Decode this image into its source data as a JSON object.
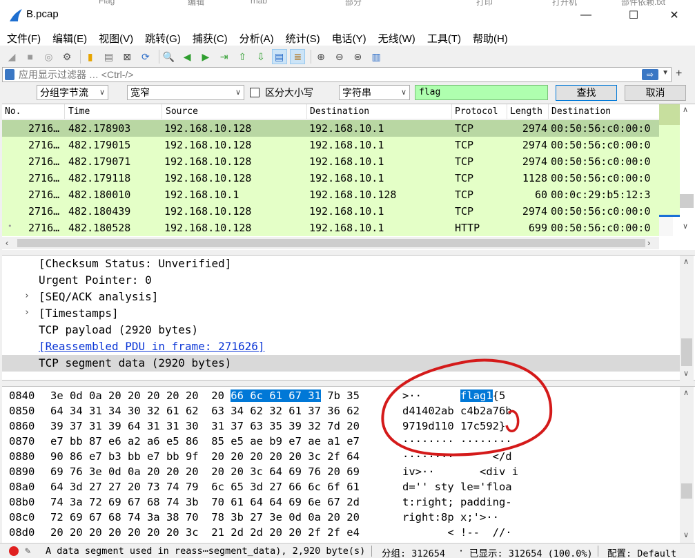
{
  "window": {
    "title": "B.pcap",
    "background_titles": [
      "Flag",
      "编辑",
      "rnab",
      "部分",
      "打印",
      "打开机",
      "部件依赖.txt"
    ],
    "controls": {
      "minimize": "—",
      "maximize": "☐",
      "close": "✕"
    }
  },
  "menu": [
    "文件(F)",
    "编辑(E)",
    "视图(V)",
    "跳转(G)",
    "捕获(C)",
    "分析(A)",
    "统计(S)",
    "电话(Y)",
    "无线(W)",
    "工具(T)",
    "帮助(H)"
  ],
  "toolbar": {
    "icons": [
      "shark-start-icon",
      "stop-icon",
      "restart-icon",
      "options-gear-icon",
      "open-folder-icon",
      "file-icon",
      "close-file-icon",
      "reload-icon",
      "find-icon",
      "go-back-icon",
      "go-forward-icon",
      "go-to-packet-icon",
      "go-first-icon",
      "go-last-icon",
      "autoscroll-icon",
      "colorize-icon",
      "zoom-in-icon",
      "zoom-out-icon",
      "zoom-normal-icon",
      "resize-columns-icon"
    ],
    "glyphs": [
      "◢",
      "■",
      "◎",
      "⚙",
      "▮",
      "▤",
      "⊠",
      "⟳",
      "🔍",
      "◀",
      "▶",
      "⇥",
      "⇧",
      "⇩",
      "▤",
      "≣",
      "⊕",
      "⊖",
      "⊜",
      "▥"
    ]
  },
  "display_filter": {
    "placeholder": "应用显示过滤器 … <Ctrl-/>",
    "apply_arrow": "⇨",
    "add": "+"
  },
  "find": {
    "search_in": "分组字节流",
    "charset": "宽窄",
    "case_sensitive_label": "区分大小写",
    "search_type": "字符串",
    "query": "flag",
    "find_button": "查找",
    "cancel_button": "取消"
  },
  "packet_list": {
    "columns": [
      "No.",
      "Time",
      "Source",
      "Destination",
      "Protocol",
      "Length",
      "Destination"
    ],
    "rows": [
      {
        "no": "2716…",
        "time": "482.178903",
        "src": "192.168.10.128",
        "dst": "192.168.10.1",
        "proto": "TCP",
        "len": "2974",
        "dst2": "00:50:56:c0:00:0"
      },
      {
        "no": "2716…",
        "time": "482.179015",
        "src": "192.168.10.128",
        "dst": "192.168.10.1",
        "proto": "TCP",
        "len": "2974",
        "dst2": "00:50:56:c0:00:0"
      },
      {
        "no": "2716…",
        "time": "482.179071",
        "src": "192.168.10.128",
        "dst": "192.168.10.1",
        "proto": "TCP",
        "len": "2974",
        "dst2": "00:50:56:c0:00:0"
      },
      {
        "no": "2716…",
        "time": "482.179118",
        "src": "192.168.10.128",
        "dst": "192.168.10.1",
        "proto": "TCP",
        "len": "1128",
        "dst2": "00:50:56:c0:00:0"
      },
      {
        "no": "2716…",
        "time": "482.180010",
        "src": "192.168.10.1",
        "dst": "192.168.10.128",
        "proto": "TCP",
        "len": "60",
        "dst2": "00:0c:29:b5:12:3"
      },
      {
        "no": "2716…",
        "time": "482.180439",
        "src": "192.168.10.128",
        "dst": "192.168.10.1",
        "proto": "TCP",
        "len": "2974",
        "dst2": "00:50:56:c0:00:0"
      },
      {
        "no": "2716…",
        "time": "482.180528",
        "src": "192.168.10.128",
        "dst": "192.168.10.1",
        "proto": "HTTP",
        "len": "699",
        "dst2": "00:50:56:c0:00:0"
      }
    ]
  },
  "details": [
    {
      "text": "[Checksum Status: Unverified]",
      "expander": ""
    },
    {
      "text": "Urgent Pointer: 0",
      "expander": ""
    },
    {
      "text": "[SEQ/ACK analysis]",
      "expander": "›"
    },
    {
      "text": "[Timestamps]",
      "expander": "›"
    },
    {
      "text": "TCP payload (2920 bytes)",
      "expander": ""
    },
    {
      "text": "[Reassembled PDU in frame: 271626]",
      "expander": ""
    },
    {
      "text": "TCP segment data (2920 bytes)",
      "expander": ""
    }
  ],
  "bytes": [
    {
      "off": "0840",
      "hex_pre": "3e 0d 0a 20 20 20 20 20  20 ",
      "hex_hl": "66 6c 61 67 31",
      "hex_post": " 7b 35",
      "asc_pre": ">··      ",
      "asc_hl": "flag1",
      "asc_post": "{5"
    },
    {
      "off": "0850",
      "hex_pre": "64 34 31 34 30 32 61 62  63 34 62 32 61 37 36 62",
      "hex_hl": "",
      "hex_post": "",
      "asc_pre": "d41402ab c4b2a76b",
      "asc_hl": "",
      "asc_post": ""
    },
    {
      "off": "0860",
      "hex_pre": "39 37 31 39 64 31 31 30  31 37 63 35 39 32 7d 20",
      "hex_hl": "",
      "hex_post": "",
      "asc_pre": "9719d110 17c592} ",
      "asc_hl": "",
      "asc_post": ""
    },
    {
      "off": "0870",
      "hex_pre": "e7 bb 87 e6 a2 a6 e5 86  85 e5 ae b9 e7 ae a1 e7",
      "hex_hl": "",
      "hex_post": "",
      "asc_pre": "········ ········",
      "asc_hl": "",
      "asc_post": ""
    },
    {
      "off": "0880",
      "hex_pre": "90 86 e7 b3 bb e7 bb 9f  20 20 20 20 20 3c 2f 64",
      "hex_hl": "",
      "hex_post": "",
      "asc_pre": "········      </d",
      "asc_hl": "",
      "asc_post": ""
    },
    {
      "off": "0890",
      "hex_pre": "69 76 3e 0d 0a 20 20 20  20 20 3c 64 69 76 20 69",
      "hex_hl": "",
      "hex_post": "",
      "asc_pre": "iv>··       <div i",
      "asc_hl": "",
      "asc_post": ""
    },
    {
      "off": "08a0",
      "hex_pre": "64 3d 27 27 20 73 74 79  6c 65 3d 27 66 6c 6f 61",
      "hex_hl": "",
      "hex_post": "",
      "asc_pre": "d='' sty le='floa",
      "asc_hl": "",
      "asc_post": ""
    },
    {
      "off": "08b0",
      "hex_pre": "74 3a 72 69 67 68 74 3b  70 61 64 64 69 6e 67 2d",
      "hex_hl": "",
      "hex_post": "",
      "asc_pre": "t:right; padding-",
      "asc_hl": "",
      "asc_post": ""
    },
    {
      "off": "08c0",
      "hex_pre": "72 69 67 68 74 3a 38 70  78 3b 27 3e 0d 0a 20 20",
      "hex_hl": "",
      "hex_post": "",
      "asc_pre": "right:8p x;'>··  ",
      "asc_hl": "",
      "asc_post": ""
    },
    {
      "off": "08d0",
      "hex_pre": "20 20 20 20 20 20 20 3c  21 2d 2d 20 20 2f 2f e4",
      "hex_hl": "",
      "hex_post": "",
      "asc_pre": "       < !--  //·",
      "asc_hl": "",
      "asc_post": ""
    }
  ],
  "status": {
    "message": "A data segment used in reass⋯segment_data), 2,920 byte(s)",
    "packets": "分组: 312654",
    "displayed": "已显示: 312654 (100.0%)",
    "profile": "配置: Default"
  },
  "colors": {
    "selected_row": "#b9d7a3",
    "row": "#e4ffc7",
    "find_input": "#afffaf",
    "byte_highlight": "#0078d7",
    "annotation": "#d41a1a"
  }
}
